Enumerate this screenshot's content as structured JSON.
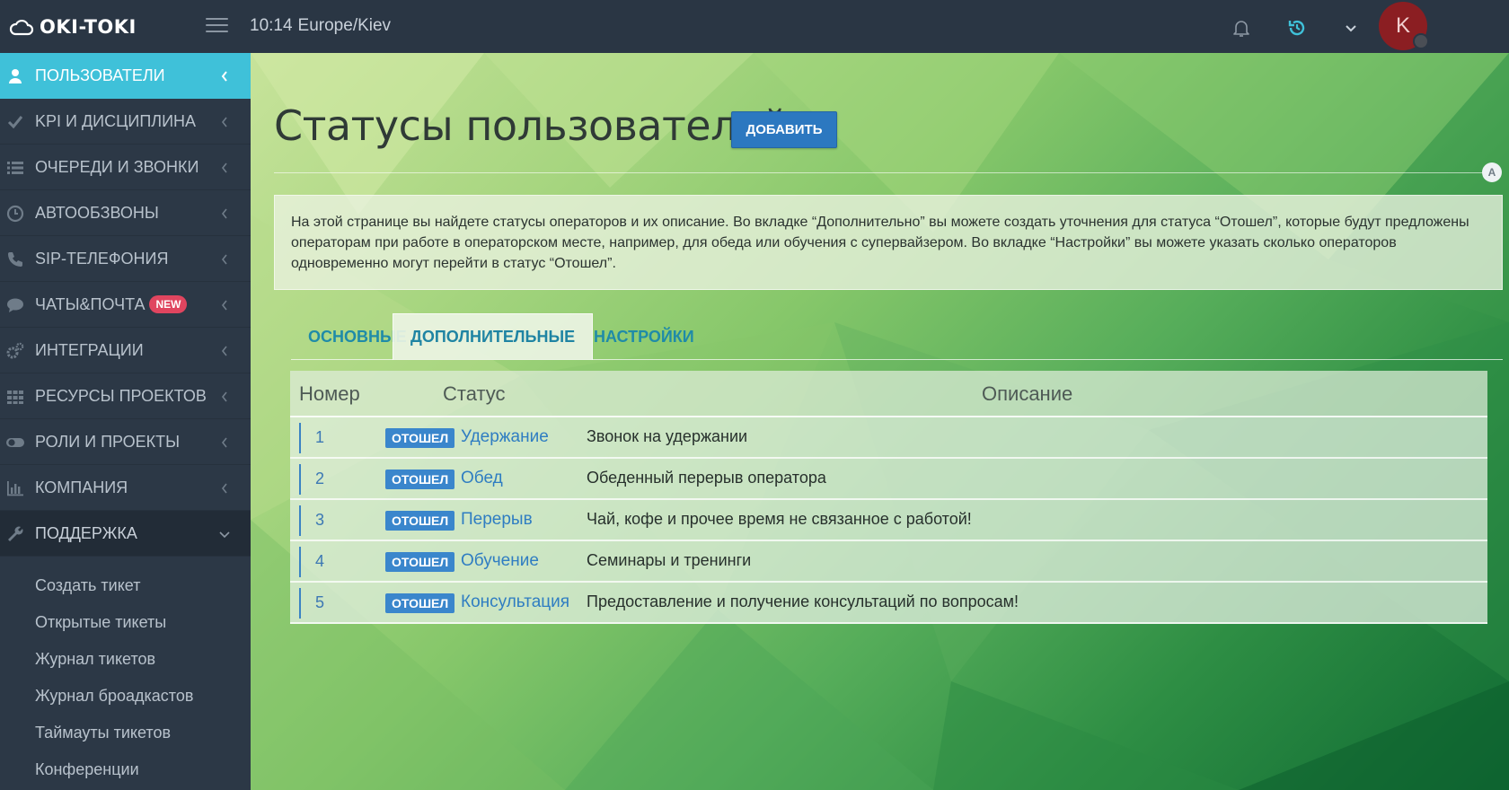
{
  "topbar": {
    "logo_text": "OKI-TOKI",
    "time": "10:14",
    "timezone": "Europe/Kiev",
    "avatar_letter": "K"
  },
  "sidebar": {
    "items": [
      {
        "label": "ПОЛЬЗОВАТЕЛИ",
        "icon": "user-icon"
      },
      {
        "label": "KPI И ДИСЦИПЛИНА",
        "icon": "check-icon"
      },
      {
        "label": "ОЧЕРЕДИ И ЗВОНКИ",
        "icon": "list-icon"
      },
      {
        "label": "АВТООБЗВОНЫ",
        "icon": "clock-icon"
      },
      {
        "label": "SIP-ТЕЛЕФОНИЯ",
        "icon": "phone-icon"
      },
      {
        "label": "ЧАТЫ&ПОЧТА",
        "icon": "chat-icon",
        "badge": "NEW"
      },
      {
        "label": "ИНТЕГРАЦИИ",
        "icon": "gears-icon"
      },
      {
        "label": "РЕСУРСЫ ПРОЕКТОВ",
        "icon": "grid-icon"
      },
      {
        "label": "РОЛИ И ПРОЕКТЫ",
        "icon": "toggle-icon"
      },
      {
        "label": "КОМПАНИЯ",
        "icon": "bar-chart-icon"
      },
      {
        "label": "ПОДДЕРЖКА",
        "icon": "wrench-icon"
      }
    ],
    "support_submenu": [
      "Создать тикет",
      "Открытые тикеты",
      "Журнал тикетов",
      "Журнал броадкастов",
      "Таймауты тикетов",
      "Конференции"
    ]
  },
  "main": {
    "title": "Статусы пользователей",
    "add_button": "ДОБАВИТЬ",
    "a_badge": "A",
    "info_text": "На этой странице вы найдете статусы операторов и их описание. Во вкладке “Дополнительно” вы можете создать уточнения для статуса “Отошел”, которые будут предложены операторам при работе в операторском месте, например, для обеда или обучения с супервайзером. Во вкладке “Настройки” вы можете указать сколько операторов одновременно могут перейти в статус “Отошел”.",
    "tabs": [
      "ОСНОВНЫЕ",
      "ДОПОЛНИТЕЛЬНЫЕ",
      "НАСТРОЙКИ"
    ],
    "table": {
      "headers": [
        "Номер",
        "Статус",
        "Описание"
      ],
      "rows": [
        {
          "num": "1",
          "tag": "ОТОШЕЛ",
          "status": "Удержание",
          "desc": "Звонок на удержании"
        },
        {
          "num": "2",
          "tag": "ОТОШЕЛ",
          "status": "Обед",
          "desc": "Обеденный перерыв оператора"
        },
        {
          "num": "3",
          "tag": "ОТОШЕЛ",
          "status": "Перерыв",
          "desc": "Чай, кофе и прочее время не связанное с работой!"
        },
        {
          "num": "4",
          "tag": "ОТОШЕЛ",
          "status": "Обучение",
          "desc": "Семинары и тренинги"
        },
        {
          "num": "5",
          "tag": "ОТОШЕЛ",
          "status": "Консультация",
          "desc": "Предоставление и получение консультаций по вопросам!"
        }
      ]
    }
  },
  "colors": {
    "sidebar_bg": "#2c3846",
    "active_item": "#3fc1d9",
    "button_blue": "#2c78c0",
    "badge_red": "#e0455f",
    "avatar": "#8b1e22"
  }
}
